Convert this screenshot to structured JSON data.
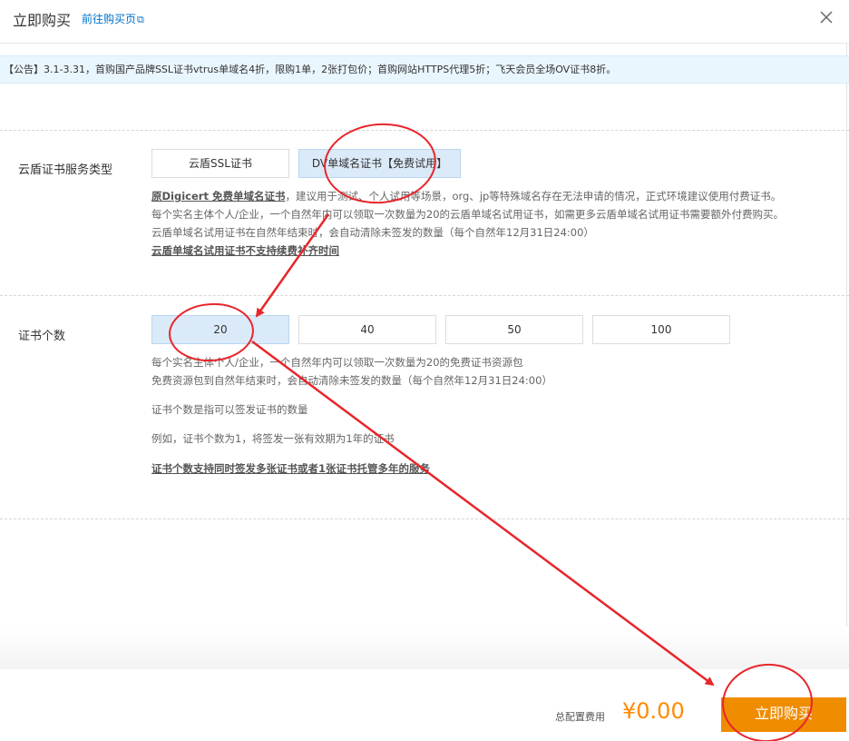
{
  "header": {
    "title": "立即购买",
    "link": "前往购买页",
    "link_icon": "external-link-icon",
    "close_icon": "close-icon"
  },
  "notice": {
    "text": "【公告】3.1-3.31，首购国产品牌SSL证书vtrus单域名4折，限购1单，2张打包价；首购网站HTTPS代理5折；飞天会员全场OV证书8折。"
  },
  "service_type": {
    "label": "云盾证书服务类型",
    "options": [
      "云盾SSL证书",
      "DV单域名证书【免费试用】"
    ],
    "selected": "DV单域名证书【免费试用】",
    "desc": {
      "line1_bold": "原Digicert 免费单域名证书",
      "line1_rest": "，建议用于测试、个人试用等场景，org、jp等特殊域名存在无法申请的情况，正式环境建议使用付费证书。",
      "line2": "每个实名主体个人/企业，一个自然年内可以领取一次数量为20的云盾单域名试用证书，如需更多云盾单域名试用证书需要额外付费购买。",
      "line3": "云盾单域名试用证书在自然年结束时，会自动清除未签发的数量（每个自然年12月31日24:00）",
      "line4": "云盾单域名试用证书不支持续费补齐时间"
    }
  },
  "cert_count": {
    "label": "证书个数",
    "options": [
      "20",
      "40",
      "50",
      "100"
    ],
    "selected": "20",
    "desc": {
      "line1": "每个实名主体个人/企业，一个自然年内可以领取一次数量为20的免费证书资源包",
      "line2": "免费资源包到自然年结束时，会自动清除未签发的数量（每个自然年12月31日24:00）",
      "line3": "证书个数是指可以签发证书的数量",
      "line4": "例如，证书个数为1，将签发一张有效期为1年的证书",
      "line5": "证书个数支持同时签发多张证书或者1张证书托管多年的服务"
    }
  },
  "footer": {
    "cost_label": "总配置费用",
    "price": "¥0.00",
    "buy_label": "立即购买"
  },
  "colors": {
    "accent_orange": "#f08c00",
    "price_orange": "#ff8a00",
    "link_blue": "#0070cc",
    "selected_bg": "#dbeaf8",
    "notice_bg": "#eaf6fe",
    "annotation_red": "#e8262b"
  }
}
